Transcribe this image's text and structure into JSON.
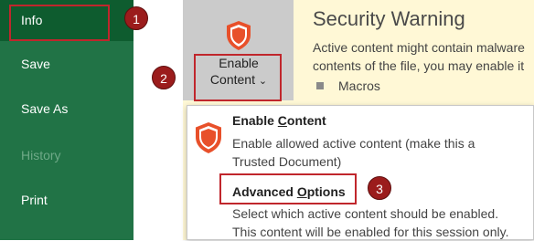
{
  "sidebar": {
    "items": [
      {
        "label": "Info"
      },
      {
        "label": "Save"
      },
      {
        "label": "Save As"
      },
      {
        "label": "History"
      },
      {
        "label": "Print"
      }
    ]
  },
  "security_warning": {
    "title": "Security Warning",
    "line1": "Active content might contain malware",
    "line2": "contents of the file, you may enable it",
    "macros_label": "Macros"
  },
  "enable_button": {
    "line1": "Enable",
    "line2": "Content",
    "chevron": "⌄"
  },
  "dropdown": {
    "enable_content": {
      "title_pre": "Enable ",
      "title_u": "C",
      "title_post": "ontent",
      "desc1": "Enable allowed active content (make this a",
      "desc2": "Trusted Document)"
    },
    "advanced_options": {
      "title_pre": "Advanced ",
      "title_u": "O",
      "title_post": "ptions",
      "desc1": "Select which active content should be enabled.",
      "desc2": "This content will be enabled for this session only."
    }
  },
  "annotations": [
    "1",
    "2",
    "3"
  ],
  "colors": {
    "sidebar_bg": "#217346",
    "sidebar_active": "#0e5c2f",
    "warning_bg": "#fff8d6",
    "shield": "#e8502a",
    "highlight_red": "#c0262c",
    "badge": "#9b1c1c"
  },
  "icons": {
    "enable_button": "shield-icon",
    "enable_content_item": "shield-icon"
  }
}
